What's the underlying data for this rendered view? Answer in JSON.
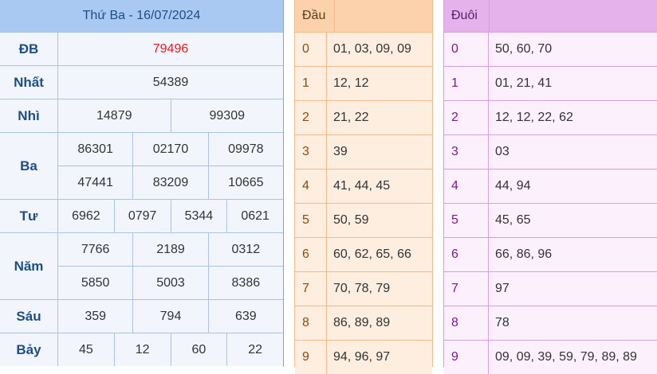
{
  "results": {
    "title": "Thứ Ba - 16/07/2024",
    "rows": [
      {
        "label": "ĐB",
        "lines": [
          [
            "79496"
          ]
        ]
      },
      {
        "label": "Nhất",
        "lines": [
          [
            "54389"
          ]
        ]
      },
      {
        "label": "Nhì",
        "lines": [
          [
            "14879",
            "99309"
          ]
        ]
      },
      {
        "label": "Ba",
        "lines": [
          [
            "86301",
            "02170",
            "09978"
          ],
          [
            "47441",
            "83209",
            "10665"
          ]
        ]
      },
      {
        "label": "Tư",
        "lines": [
          [
            "6962",
            "0797",
            "5344",
            "0621"
          ]
        ]
      },
      {
        "label": "Năm",
        "lines": [
          [
            "7766",
            "2189",
            "0312"
          ],
          [
            "5850",
            "5003",
            "8386"
          ]
        ]
      },
      {
        "label": "Sáu",
        "lines": [
          [
            "359",
            "794",
            "639"
          ]
        ]
      },
      {
        "label": "Bảy",
        "lines": [
          [
            "45",
            "12",
            "60",
            "22"
          ]
        ]
      }
    ]
  },
  "dau": {
    "header": "Đầu",
    "rows": [
      {
        "key": "0",
        "values": "01, 03, 09, 09"
      },
      {
        "key": "1",
        "values": "12, 12"
      },
      {
        "key": "2",
        "values": "21, 22"
      },
      {
        "key": "3",
        "values": "39"
      },
      {
        "key": "4",
        "values": "41, 44, 45"
      },
      {
        "key": "5",
        "values": "50, 59"
      },
      {
        "key": "6",
        "values": "60, 62, 65, 66"
      },
      {
        "key": "7",
        "values": "70, 78, 79"
      },
      {
        "key": "8",
        "values": "86, 89, 89"
      },
      {
        "key": "9",
        "values": "94, 96, 97"
      }
    ]
  },
  "duoi": {
    "header": "Đuôi",
    "rows": [
      {
        "key": "0",
        "values": "50, 60, 70"
      },
      {
        "key": "1",
        "values": "01, 21, 41"
      },
      {
        "key": "2",
        "values": "12, 12, 22, 62"
      },
      {
        "key": "3",
        "values": "03"
      },
      {
        "key": "4",
        "values": "44, 94"
      },
      {
        "key": "5",
        "values": "45, 65"
      },
      {
        "key": "6",
        "values": "66, 86, 96"
      },
      {
        "key": "7",
        "values": "97"
      },
      {
        "key": "8",
        "values": "78"
      },
      {
        "key": "9",
        "values": "09, 09, 39, 59, 79, 89, 89"
      }
    ]
  },
  "colors": {
    "special_prize": "#e8141b",
    "results_header": "#a9c8f2",
    "dau_header": "#fbd2ab",
    "duoi_header": "#e6b2ec"
  }
}
